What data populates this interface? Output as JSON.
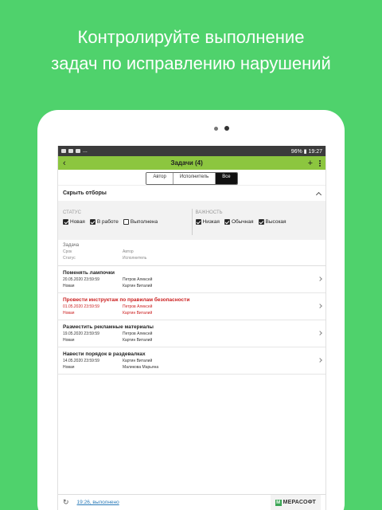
{
  "headline": {
    "line1": "Контролируйте выполнение",
    "line2": "задач по исправлению нарушений"
  },
  "statusbar": {
    "left_text": "...",
    "right_text": "96% ▮ 19:27"
  },
  "appbar": {
    "back_icon": "arrow-left-icon",
    "title": "Задачи (4)",
    "add_label": "+",
    "menu_icon": "more-vertical-icon"
  },
  "segments": {
    "items": [
      "Автор",
      "Исполнитель",
      "Все"
    ],
    "selected": "Все"
  },
  "filters": {
    "toggle_label": "Скрыть отборы",
    "status": {
      "title": "СТАТУС",
      "items": [
        {
          "label": "Новая",
          "checked": true
        },
        {
          "label": "В работе",
          "checked": true
        },
        {
          "label": "Выполнена",
          "checked": false
        }
      ]
    },
    "importance": {
      "title": "ВАЖНОСТЬ",
      "items": [
        {
          "label": "Низкая",
          "checked": true
        },
        {
          "label": "Обычная",
          "checked": true
        },
        {
          "label": "Высокая",
          "checked": true
        }
      ]
    }
  },
  "columns": {
    "task": "Задача",
    "deadline": "Срок",
    "author": "Автор",
    "status": "Статус",
    "executor": "Исполнитель"
  },
  "tasks": [
    {
      "name": "Поменять лампочки",
      "deadline": "20.05.2020 23:59:59",
      "author": "Петров Алексей",
      "status": "Новая",
      "executor": "Картин Виталий",
      "urgent": false
    },
    {
      "name": "Провести инструктаж по правилам безопасности",
      "deadline": "01.05.2020 23:59:59",
      "author": "Петров Алексей",
      "status": "Новая",
      "executor": "Картин Виталий",
      "urgent": true
    },
    {
      "name": "Разместить рекламные материалы",
      "deadline": "19.05.2020 23:59:59",
      "author": "Петров Алексей",
      "status": "Новая",
      "executor": "Картин Виталий",
      "urgent": false
    },
    {
      "name": "Навести порядок в раздевалках",
      "deadline": "14.05.2020 23:59:59",
      "author": "Картин Виталий",
      "status": "Новая",
      "executor": "Маликова Марьяна",
      "urgent": false
    }
  ],
  "footer": {
    "sync_text": "19:26, выполнено",
    "brand_logo": "M",
    "brand_name": "МЕРАСОФТ"
  },
  "colors": {
    "background": "#4fd26c",
    "appbar": "#8cc63f",
    "urgent": "#cc2020",
    "link": "#2a7ab8"
  }
}
